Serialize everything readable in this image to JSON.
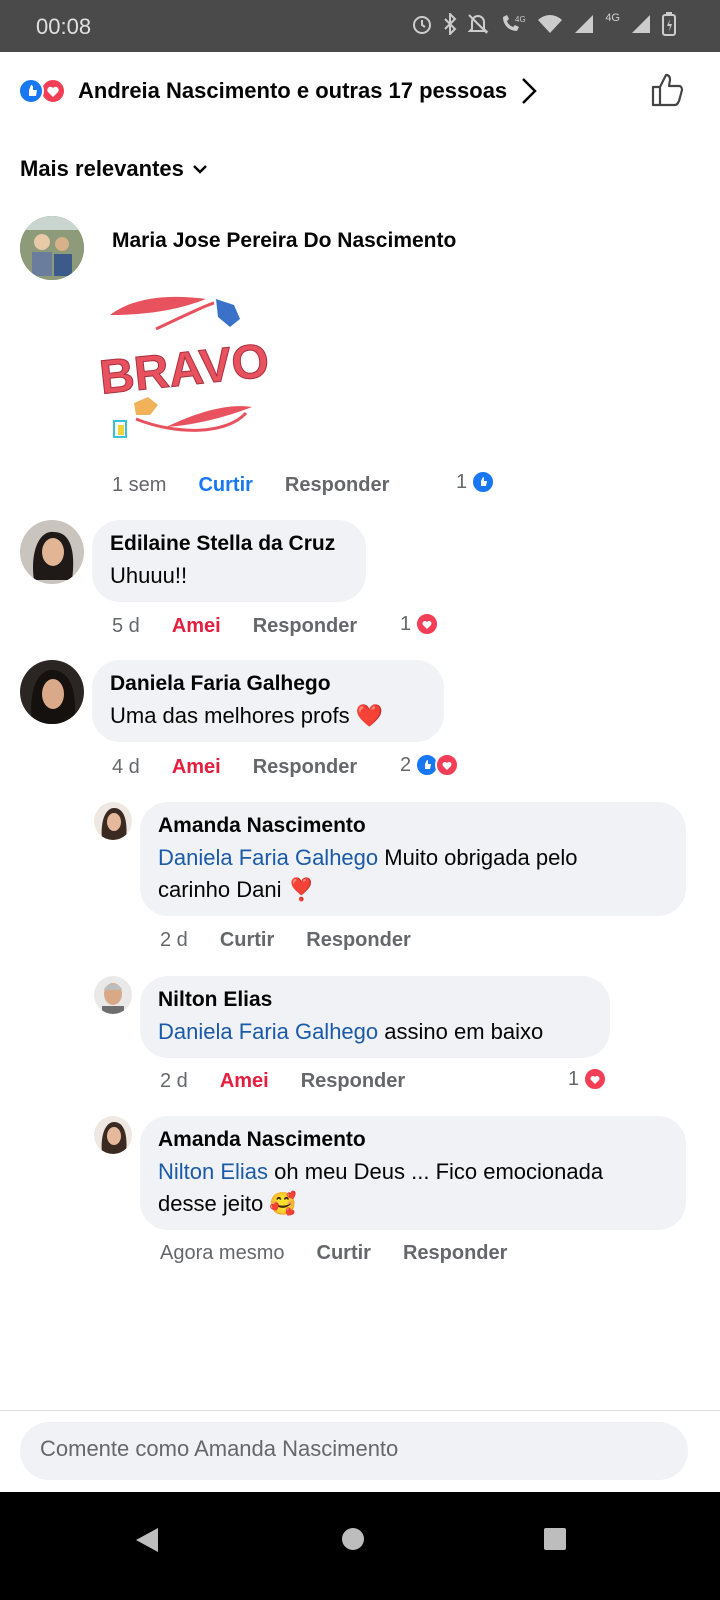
{
  "status": {
    "time": "00:08",
    "icons": [
      "alarm-icon",
      "bluetooth-icon",
      "mute-icon",
      "volte-icon",
      "wifi-icon",
      "signal-icon",
      "network-4g-icon",
      "signal-icon-2",
      "battery-icon"
    ],
    "network_label": "4G"
  },
  "header": {
    "reactors": "Andreia Nascimento e outras 17 pessoas",
    "reaction_icons": [
      "like-icon",
      "love-icon"
    ]
  },
  "sort": {
    "label": "Mais relevantes"
  },
  "comments": [
    {
      "author": "Maria Jose Pereira Do Nascimento",
      "sticker_text": "BRAVO",
      "time": "1 sem",
      "reaction_action": "Curtir",
      "reply": "Responder",
      "count": "1"
    },
    {
      "author": "Edilaine Stella da Cruz",
      "text": "Uhuuu!!",
      "time": "5 d",
      "reaction_action": "Amei",
      "reply": "Responder",
      "count": "1"
    },
    {
      "author": "Daniela Faria Galhego",
      "text": "Uma das melhores profs ❤️",
      "time": "4 d",
      "reaction_action": "Amei",
      "reply": "Responder",
      "count": "2"
    }
  ],
  "replies": [
    {
      "author": "Amanda Nascimento",
      "mention": "Daniela Faria Galhego",
      "text_line1": " Muito obrigada pelo",
      "text_line2": "carinho Dani ❣️",
      "time": "2 d",
      "reaction_action": "Curtir",
      "reply": "Responder"
    },
    {
      "author": "Nilton Elias",
      "mention": "Daniela Faria Galhego",
      "text_line1": " assino em baixo",
      "time": "2 d",
      "reaction_action": "Amei",
      "reply": "Responder",
      "count": "1"
    },
    {
      "author": "Amanda Nascimento",
      "mention": "Nilton Elias",
      "text_line1": " oh meu Deus ... Fico emocionada",
      "text_line2": "desse jeito 🥰",
      "time": "Agora mesmo",
      "reaction_action": "Curtir",
      "reply": "Responder"
    }
  ],
  "composer": {
    "placeholder": "Comente como Amanda Nascimento"
  },
  "colors": {
    "like": "#1877f2",
    "love": "#f33e58",
    "mention": "#1a5aa8",
    "bubble": "#f0f2f5"
  }
}
